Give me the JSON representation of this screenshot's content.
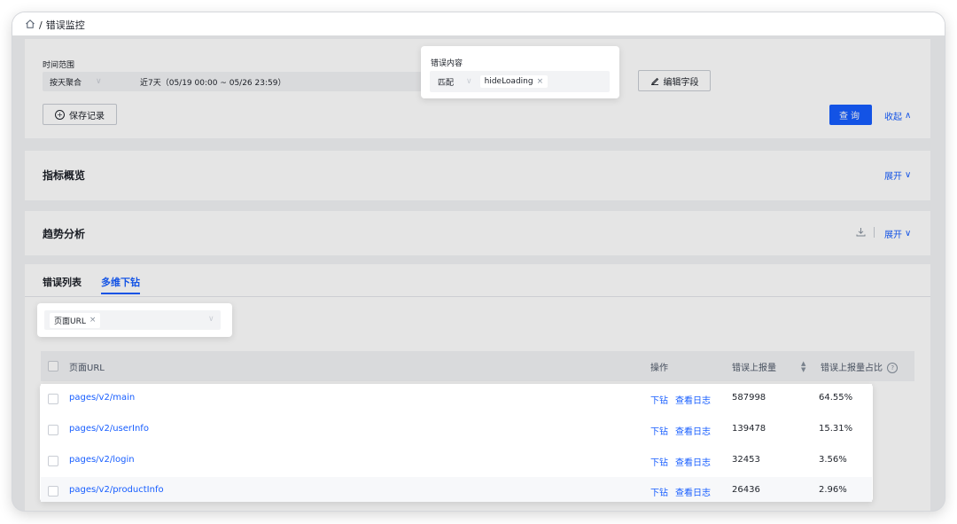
{
  "breadcrumb": {
    "separator": "/",
    "current": "错误监控"
  },
  "filters": {
    "time_range_label": "时间范围",
    "aggregate_value": "按天聚合",
    "range_value": "近7天（05/19 00:00 ~ 05/26 23:59）",
    "error_content_label": "错误内容",
    "match_mode": "匹配",
    "error_tag": "hideLoading",
    "edit_fields_label": "编辑字段",
    "save_record_label": "保存记录",
    "query_label": "查询",
    "collapse_label": "收起"
  },
  "sections": {
    "overview_title": "指标概览",
    "overview_expand": "展开",
    "trend_title": "趋势分析",
    "trend_expand": "展开"
  },
  "tabs": [
    {
      "label": "错误列表",
      "active": false
    },
    {
      "label": "多维下钻",
      "active": true
    }
  ],
  "dimension_select": {
    "tag": "页面URL"
  },
  "table": {
    "headers": {
      "page_url": "页面URL",
      "actions": "操作",
      "error_count": "错误上报量",
      "error_ratio": "错误上报量占比"
    },
    "action_drill": "下钻",
    "action_logs": "查看日志",
    "rows": [
      {
        "url": "pages/v2/main",
        "count": "587998",
        "ratio": "64.55%"
      },
      {
        "url": "pages/v2/userInfo",
        "count": "139478",
        "ratio": "15.31%"
      },
      {
        "url": "pages/v2/login",
        "count": "32453",
        "ratio": "3.56%"
      },
      {
        "url": "pages/v2/productInfo",
        "count": "26436",
        "ratio": "2.96%"
      }
    ]
  },
  "colors": {
    "accent": "#165dff",
    "page_bg": "#f2f3f5",
    "text": "#1d2129"
  }
}
